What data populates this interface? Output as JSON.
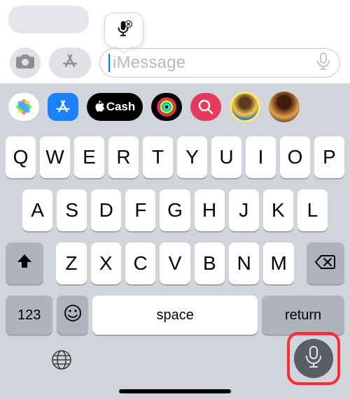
{
  "compose": {
    "placeholder": "iMessage"
  },
  "app_strip": {
    "cash_label": "Cash"
  },
  "keyboard": {
    "row1": [
      "Q",
      "W",
      "E",
      "R",
      "T",
      "Y",
      "U",
      "I",
      "O",
      "P"
    ],
    "row2": [
      "A",
      "S",
      "D",
      "F",
      "G",
      "H",
      "J",
      "K",
      "L"
    ],
    "row3": [
      "Z",
      "X",
      "C",
      "V",
      "B",
      "N",
      "M"
    ],
    "numbers_label": "123",
    "space_label": "space",
    "return_label": "return"
  }
}
